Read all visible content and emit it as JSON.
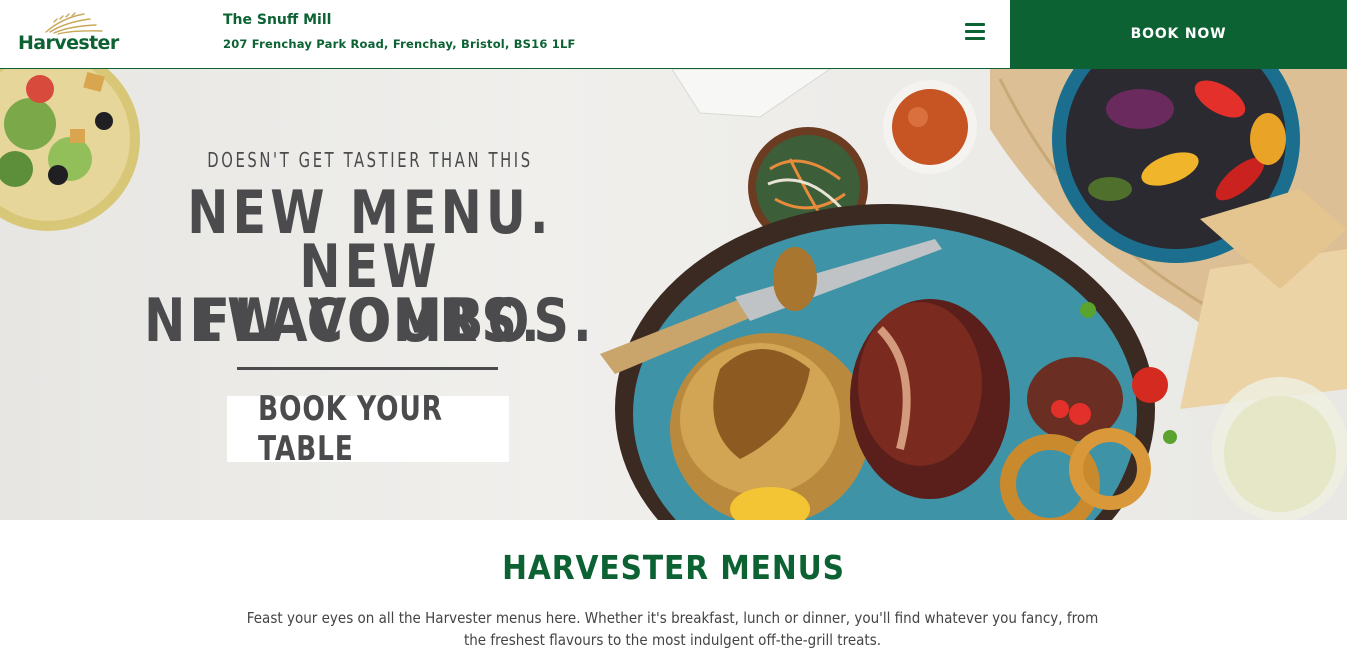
{
  "header": {
    "logo_text": "Harvester",
    "restaurant_name": "The Snuff Mill",
    "restaurant_address": "207 Frenchay Park Road, Frenchay, Bristol, BS16 1LF",
    "menu_icon": "hamburger-menu-icon",
    "book_now_label": "BOOK NOW"
  },
  "hero": {
    "tagline": "DOESN'T GET TASTIER THAN THIS",
    "headline": [
      "NEW MENU.",
      "NEW FLAVOURS.",
      "NEW COMBOS."
    ],
    "cta_label": "BOOK YOUR TABLE"
  },
  "menus": {
    "title": "HARVESTER MENUS",
    "description": "Feast your eyes on all the Harvester menus here. Whether it's breakfast, lunch or dinner, you'll find whatever you fancy, from the freshest flavours to the most indulgent off-the-grill treats."
  },
  "colors": {
    "brand_green": "#0d6234",
    "text_grey": "#4b4b4d"
  }
}
